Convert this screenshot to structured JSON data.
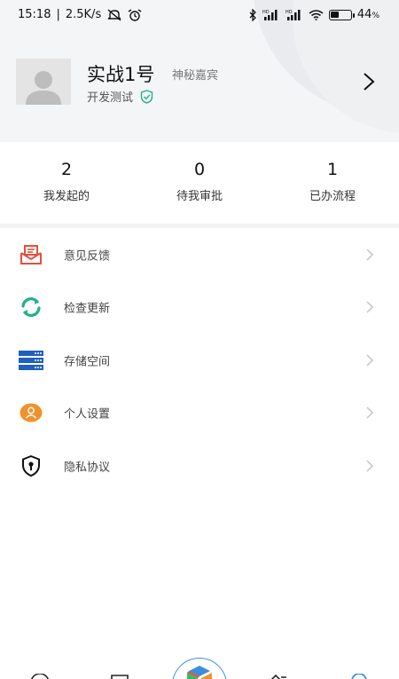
{
  "status_bar": {
    "time": "15:18",
    "network_speed": "2.5K/s",
    "battery_text": "44",
    "battery_unit": "%",
    "battery_level": 0.44
  },
  "profile": {
    "name": "实战1号",
    "tag": "神秘嘉宾",
    "department": "开发测试"
  },
  "stats": [
    {
      "value": "2",
      "label": "我发起的"
    },
    {
      "value": "0",
      "label": "待我审批"
    },
    {
      "value": "1",
      "label": "已办流程"
    }
  ],
  "menu": [
    {
      "label": "意见反馈",
      "icon": "feedback-mail-icon",
      "color": "#e0523f"
    },
    {
      "label": "检查更新",
      "icon": "refresh-icon",
      "color": "#22b28a"
    },
    {
      "label": "存储空间",
      "icon": "storage-server-icon",
      "color": "#1f5fbf"
    },
    {
      "label": "个人设置",
      "icon": "person-icon",
      "color": "#f0922b"
    },
    {
      "label": "隐私协议",
      "icon": "shield-lock-icon",
      "color": "#111111"
    }
  ],
  "colors": {
    "header_bg": "#f4f5f7",
    "accent_blue": "#3a8fd9",
    "verified_green": "#22b28a"
  }
}
